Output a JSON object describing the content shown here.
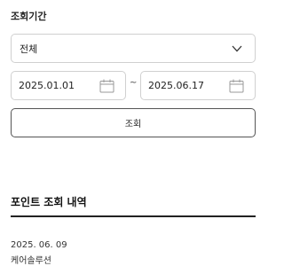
{
  "filter": {
    "period_label": "조회기간",
    "period_select_value": "전체",
    "date_from": "2025.01.01",
    "date_to": "2025.06.17",
    "date_separator": "~",
    "search_button_label": "조회"
  },
  "history": {
    "title": "포인트 조회 내역",
    "entries": [
      {
        "date": "2025. 06. 09",
        "description": "케어솔루션"
      }
    ]
  },
  "icons": {
    "select_chevron": "chevron-down-icon",
    "date_picker": "calendar-icon"
  },
  "colors": {
    "border": "#d0d0d0",
    "button_border": "#555555",
    "divider": "#222222",
    "text": "#222222"
  }
}
